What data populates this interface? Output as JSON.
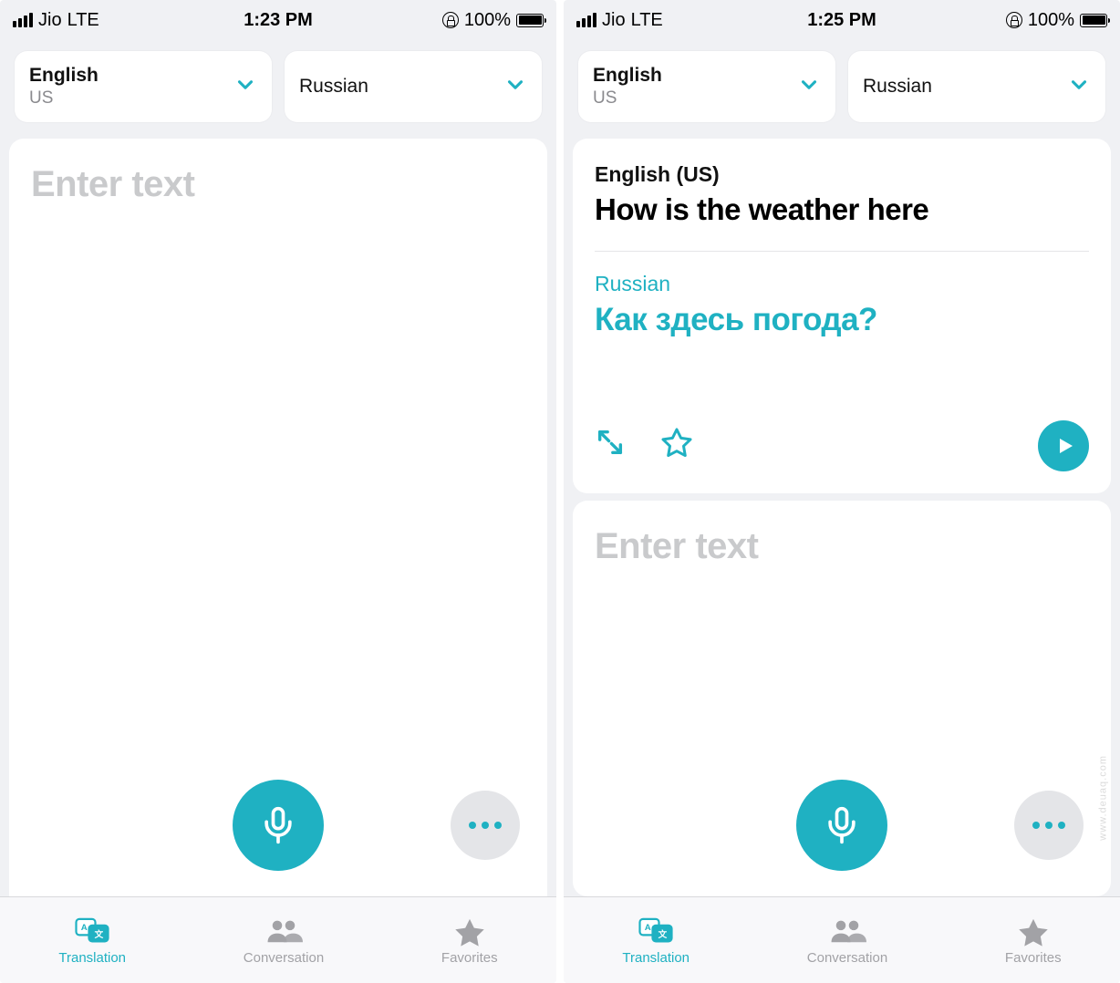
{
  "accent": "#1fb1c2",
  "screens": [
    {
      "status": {
        "carrier": "Jio",
        "net": "LTE",
        "time": "1:23 PM",
        "battery": "100%"
      },
      "src_lang": {
        "name": "English",
        "sub": "US"
      },
      "tgt_lang": {
        "name": "Russian"
      }
    },
    {
      "status": {
        "carrier": "Jio",
        "net": "LTE",
        "time": "1:25 PM",
        "battery": "100%"
      },
      "src_lang": {
        "name": "English",
        "sub": "US"
      },
      "tgt_lang": {
        "name": "Russian"
      },
      "result": {
        "src_label": "English (US)",
        "src_text": "How is the weather here",
        "tgt_label": "Russian",
        "tgt_text": "Как здесь погода?"
      }
    }
  ],
  "placeholder": "Enter text",
  "tabs": {
    "translation": "Translation",
    "conversation": "Conversation",
    "favorites": "Favorites"
  },
  "watermark": "www.deuaq.com"
}
